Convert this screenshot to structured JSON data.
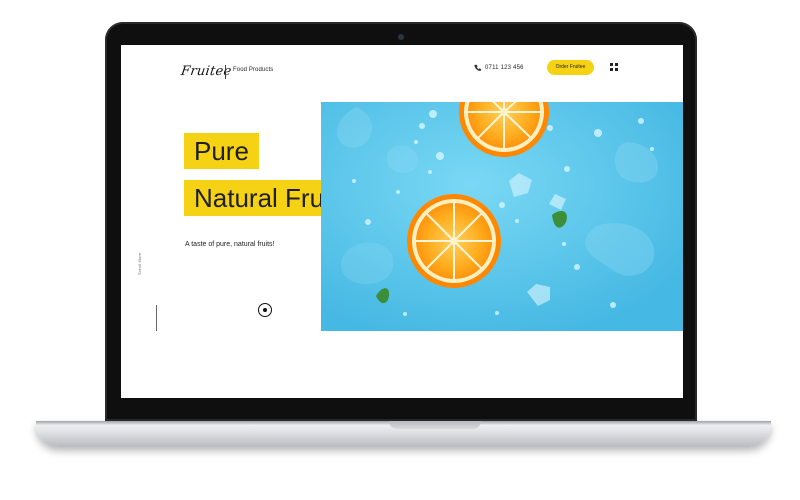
{
  "header": {
    "logo": "Fruitee",
    "tagline": "Food Products",
    "phone": "0711 123 456",
    "order_label": "Order Fruitee"
  },
  "hero": {
    "title_line_1": "Pure",
    "title_line_2": "Natural Fruits",
    "subtitle": "A taste of pure, natural fruits!",
    "scroll_label": "Scroll More"
  },
  "colors": {
    "accent": "#f5d214",
    "image_background": "#58c6ea",
    "orange": "#ff9a0c"
  },
  "icons": {
    "phone": "phone-icon",
    "menu": "grid-menu-icon",
    "scroll": "scroll-down-icon"
  }
}
